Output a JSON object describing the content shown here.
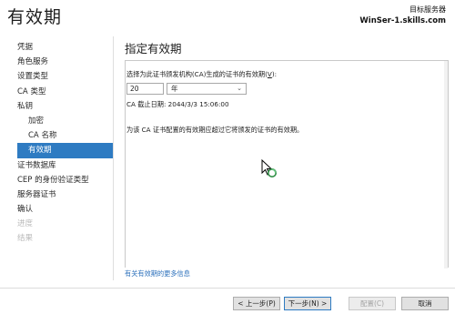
{
  "header": {
    "title": "有效期",
    "target_label": "目标服务器",
    "target_server": "WinSer-1.skills.com"
  },
  "nav": {
    "items": [
      {
        "label": "凭据",
        "indent": false,
        "state": "normal"
      },
      {
        "label": "角色服务",
        "indent": false,
        "state": "normal"
      },
      {
        "label": "设置类型",
        "indent": false,
        "state": "normal"
      },
      {
        "label": "CA 类型",
        "indent": false,
        "state": "normal"
      },
      {
        "label": "私钥",
        "indent": false,
        "state": "normal"
      },
      {
        "label": "加密",
        "indent": true,
        "state": "normal"
      },
      {
        "label": "CA 名称",
        "indent": true,
        "state": "normal"
      },
      {
        "label": "有效期",
        "indent": true,
        "state": "selected"
      },
      {
        "label": "证书数据库",
        "indent": false,
        "state": "normal"
      },
      {
        "label": "CEP 的身份验证类型",
        "indent": false,
        "state": "normal"
      },
      {
        "label": "服务器证书",
        "indent": false,
        "state": "normal"
      },
      {
        "label": "确认",
        "indent": false,
        "state": "normal"
      },
      {
        "label": "进度",
        "indent": false,
        "state": "disabled"
      },
      {
        "label": "结果",
        "indent": false,
        "state": "disabled"
      }
    ]
  },
  "main": {
    "section_title": "指定有效期",
    "description_prefix": "选择为此证书颁发机构(CA)生成的证书的有效期(",
    "description_accel": "V",
    "description_suffix": "):",
    "period_value": "20",
    "period_unit": "年",
    "expiry_line": "CA 截止日期: 2044/3/3 15:06:00",
    "warning_line": "为该 CA 证书配置的有效期应超过它将颁发的证书的有效期。",
    "more_link": "有关有效期的更多信息"
  },
  "buttons": {
    "back": "< 上一步(P)",
    "next": "下一步(N) >",
    "configure": "配置(C)",
    "cancel": "取消"
  }
}
